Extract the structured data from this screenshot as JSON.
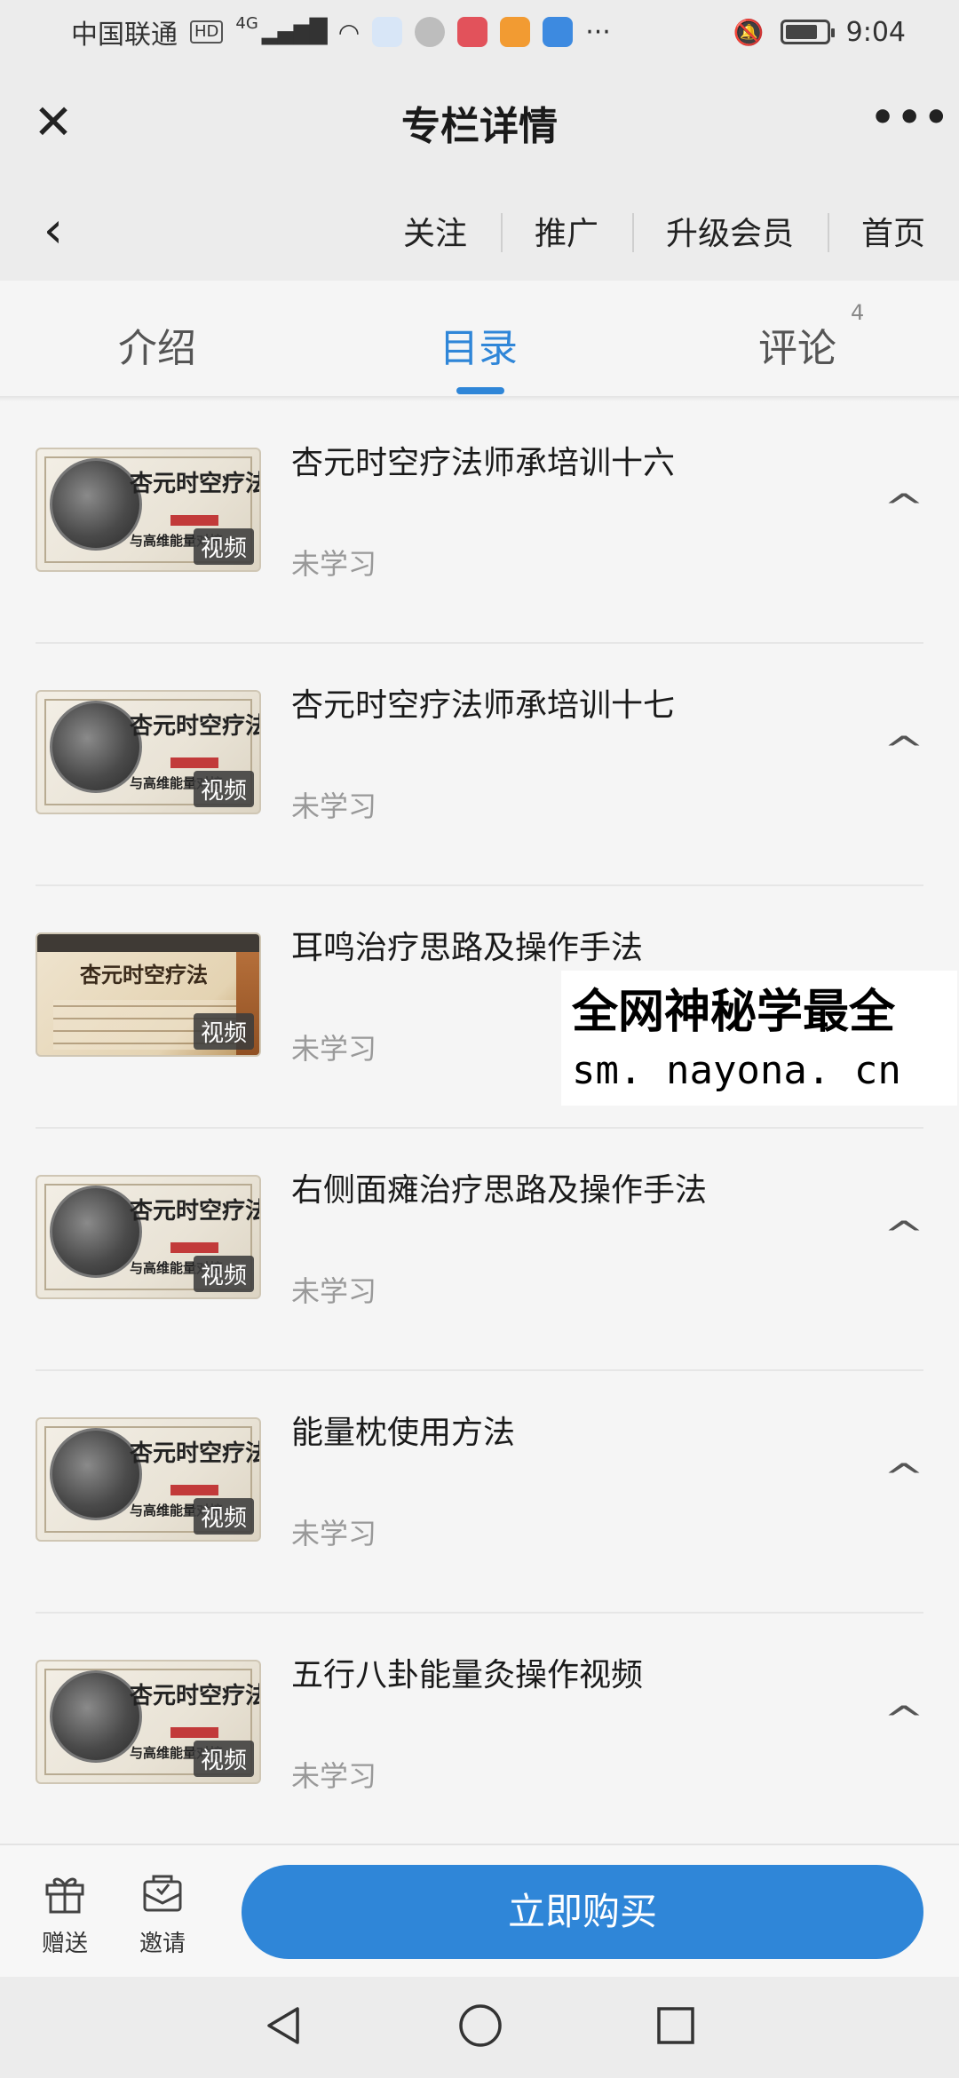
{
  "status_bar": {
    "carrier": "中国联通",
    "hd": "HD",
    "network": "4G",
    "time": "9:04",
    "battery_level": 0.8
  },
  "title_bar": {
    "title": "专栏详情",
    "close_icon": "close-icon",
    "more_icon": "more-icon"
  },
  "nav_row": {
    "back_icon": "chevron-left-icon",
    "links": [
      "关注",
      "推广",
      "升级会员",
      "首页"
    ]
  },
  "tabs": {
    "items": [
      "介绍",
      "目录",
      "评论"
    ],
    "active": "目录",
    "comment_count": "4"
  },
  "list": {
    "items": [
      {
        "title": "杏元时空疗法师承培训十六",
        "status": "未学习",
        "tag": "视频"
      },
      {
        "title": "杏元时空疗法师承培训十七",
        "status": "未学习",
        "tag": "视频"
      },
      {
        "title": "耳鸣治疗思路及操作手法",
        "status": "未学习",
        "tag": "视频"
      },
      {
        "title": "右侧面瘫治疗思路及操作手法",
        "status": "未学习",
        "tag": "视频"
      },
      {
        "title": "能量枕使用方法",
        "status": "未学习",
        "tag": "视频"
      },
      {
        "title": "五行八卦能量灸操作视频",
        "status": "未学习",
        "tag": "视频"
      }
    ],
    "thumb_title": "杏元时空疗法",
    "thumb_tagline": "与高维能量对接"
  },
  "watermark": {
    "line1": "全网神秘学最全",
    "line2": "sm. nayona. cn"
  },
  "action_bar": {
    "gift_label": "赠送",
    "invite_label": "邀请",
    "buy_label": "立即购买"
  },
  "colors": {
    "accent": "#2f86d8",
    "muted_text": "#999999",
    "status_bar_bg": "#ececec"
  }
}
